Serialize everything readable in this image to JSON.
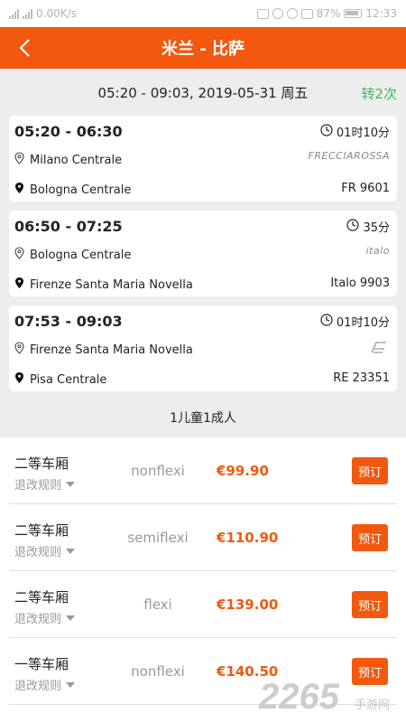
{
  "status_bar": {
    "speed": "0.00K/s",
    "battery": "87%",
    "time": "12:33"
  },
  "header": {
    "title": "米兰 - 比萨"
  },
  "summary": {
    "text": "05:20 - 09:03, 2019-05-31 周五",
    "transfer": "转2次"
  },
  "legs": [
    {
      "time": "05:20 - 06:30",
      "duration": "01时10分",
      "from": "Milano Centrale",
      "to": "Bologna Centrale",
      "logo": "FRECCIAROSSA",
      "train": "FR 9601"
    },
    {
      "time": "06:50 - 07:25",
      "duration": "35分",
      "from": "Bologna Centrale",
      "to": "Firenze Santa Maria Novella",
      "logo": "italo",
      "train": "Italo 9903"
    },
    {
      "time": "07:53 - 09:03",
      "duration": "01时10分",
      "from": "Firenze Santa Maria Novella",
      "to": "Pisa Centrale",
      "logo": "",
      "train": "RE 23351"
    }
  ],
  "passengers": "1儿童1成人",
  "fares": [
    {
      "class": "二等车厢",
      "rule": "退改规则",
      "type": "nonflexi",
      "price": "€99.90",
      "book": "预订"
    },
    {
      "class": "二等车厢",
      "rule": "退改规则",
      "type": "semiflexi",
      "price": "€110.90",
      "book": "预订"
    },
    {
      "class": "二等车厢",
      "rule": "退改规则",
      "type": "flexi",
      "price": "€139.00",
      "book": "预订"
    },
    {
      "class": "一等车厢",
      "rule": "退改规则",
      "type": "nonflexi",
      "price": "€140.50",
      "book": "预订"
    }
  ],
  "watermark": {
    "number": "2265",
    "site": "手游网"
  },
  "colors": {
    "accent": "#f2590f",
    "transfer": "#3fb94f"
  }
}
